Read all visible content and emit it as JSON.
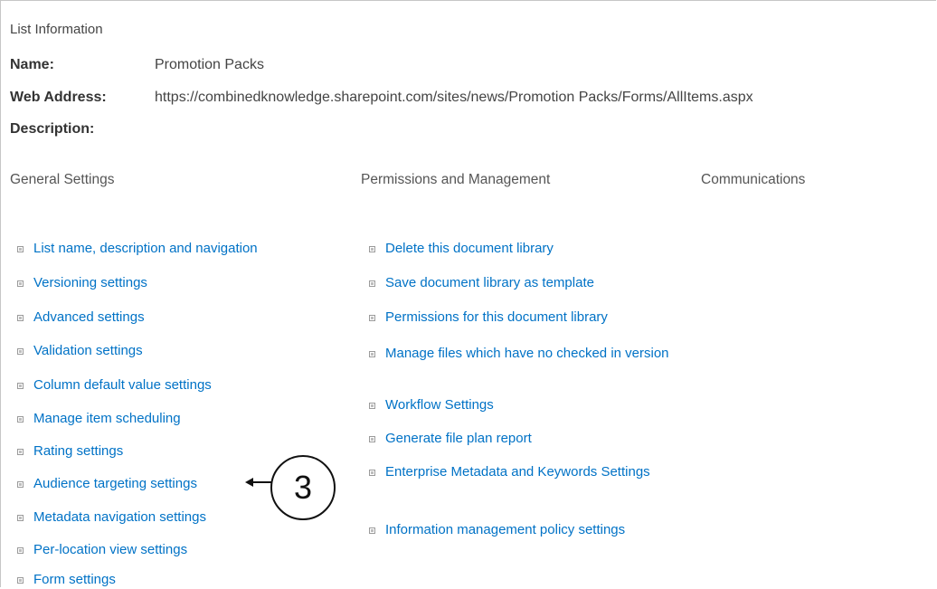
{
  "list_info": {
    "title": "List Information",
    "name_label": "Name:",
    "name_value": "Promotion Packs",
    "web_address_label": "Web Address:",
    "web_address_value": "https://combinedknowledge.sharepoint.com/sites/news/Promotion Packs/Forms/AllItems.aspx",
    "description_label": "Description:"
  },
  "columns": {
    "general": "General Settings",
    "permissions": "Permissions and Management",
    "communications": "Communications"
  },
  "general_links": [
    "List name, description and navigation",
    "Versioning settings",
    "Advanced settings",
    "Validation settings",
    "Column default value settings",
    "Manage item scheduling",
    "Rating settings",
    "Audience targeting settings",
    "Metadata navigation settings",
    "Per-location view settings",
    "Form settings"
  ],
  "permission_links": [
    "Delete this document library",
    "Save document library as template",
    "Permissions for this document library",
    "Manage files which have no checked in version",
    "Workflow Settings",
    "Generate file plan report",
    "Enterprise Metadata and Keywords Settings",
    "Information management policy settings"
  ],
  "callout": {
    "number": "3"
  },
  "colors": {
    "link": "#0072c6",
    "text": "#444444"
  }
}
